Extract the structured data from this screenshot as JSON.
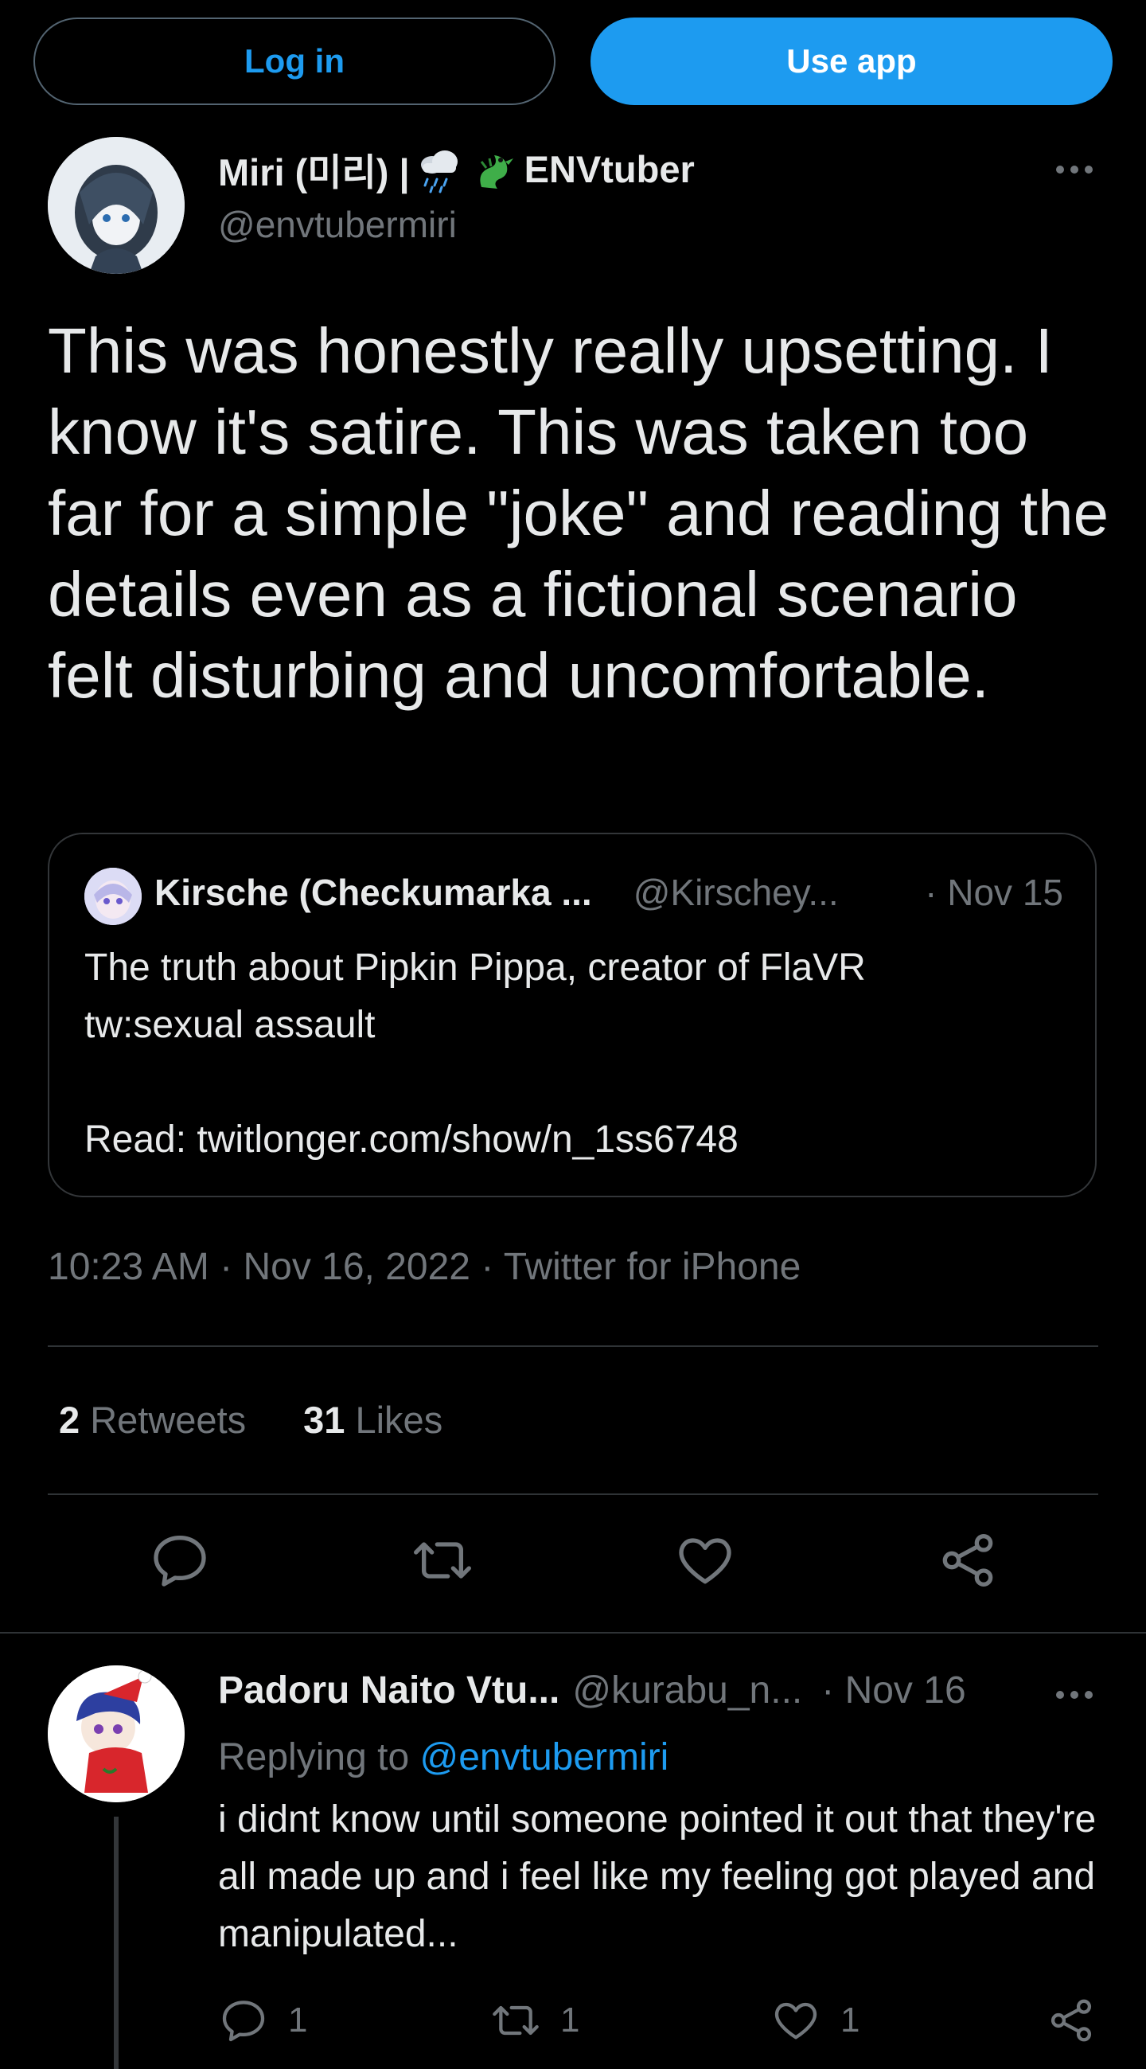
{
  "header": {
    "login_label": "Log in",
    "app_label": "Use app"
  },
  "tweet": {
    "name_prefix": "Miri (미리) |",
    "name_suffix": "ENVtuber",
    "handle": "@envtubermiri",
    "text": "This was honestly really upsetting. I know it's satire. This was taken too far for a simple \"joke\" and reading the details even as a fictional scenario felt disturbing and uncomfortable.",
    "time": "10:23 AM · Nov 16, 2022 · Twitter for iPhone",
    "retweets_count": "2",
    "retweets_label": "Retweets",
    "likes_count": "31",
    "likes_label": "Likes"
  },
  "quote": {
    "name": "Kirsche (Checkumarka ...",
    "handle": "@Kirschey...",
    "date": "· Nov 15",
    "line1": "The truth about Pipkin Pippa, creator of FlaVR",
    "line2": "tw:sexual assault",
    "line3": "",
    "line4": "Read: twitlonger.com/show/n_1ss6748"
  },
  "reply": {
    "name": "Padoru Naito Vtu...",
    "handle": "@kurabu_n...",
    "date": "· Nov 16",
    "replying_prefix": "Replying to",
    "replying_to": "@envtubermiri",
    "text": "i didnt know until someone pointed it out that they're all made up and i feel like my feeling got played and manipulated...",
    "reply_count": "1",
    "retweet_count": "1",
    "like_count": "1"
  },
  "icons": {
    "reply": "reply-icon",
    "retweet": "retweet-icon",
    "like": "heart-icon",
    "share": "share-icon",
    "more": "more-icon"
  },
  "colors": {
    "accent": "#1d9bf0",
    "background": "#000000",
    "text": "#e7e9ea",
    "muted": "#71767b"
  }
}
